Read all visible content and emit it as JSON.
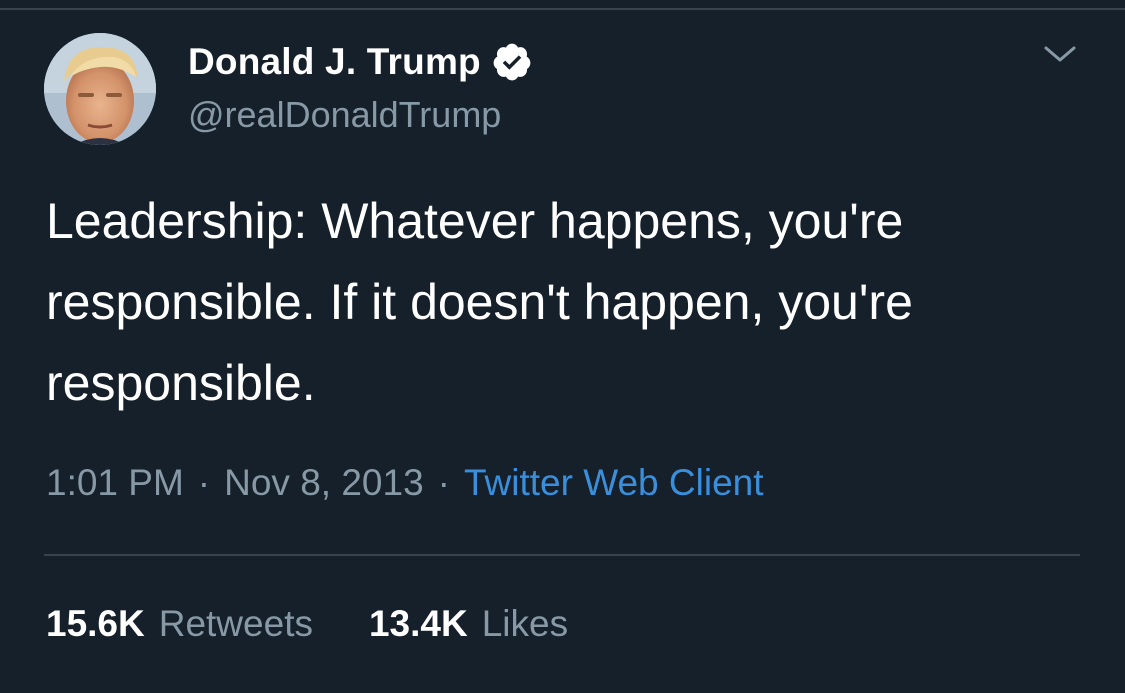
{
  "tweet": {
    "author": {
      "display_name": "Donald J. Trump",
      "handle": "@realDonaldTrump",
      "verified": true,
      "avatar_icon": "profile-photo"
    },
    "text": "Leadership: Whatever happens, you're responsible. If it doesn't happen, you're responsible.",
    "time": "1:01 PM",
    "separator": "·",
    "date": "Nov 8, 2013",
    "source": "Twitter Web Client",
    "stats": {
      "retweets_count": "15.6K",
      "retweets_label": "Retweets",
      "likes_count": "13.4K",
      "likes_label": "Likes"
    }
  },
  "icons": {
    "verified": "verified-badge-icon",
    "menu": "chevron-down-icon"
  },
  "colors": {
    "background": "#15202b",
    "primary_text": "#ffffff",
    "secondary_text": "#8899a6",
    "link": "#3a8fdc",
    "divider": "#38444d"
  }
}
